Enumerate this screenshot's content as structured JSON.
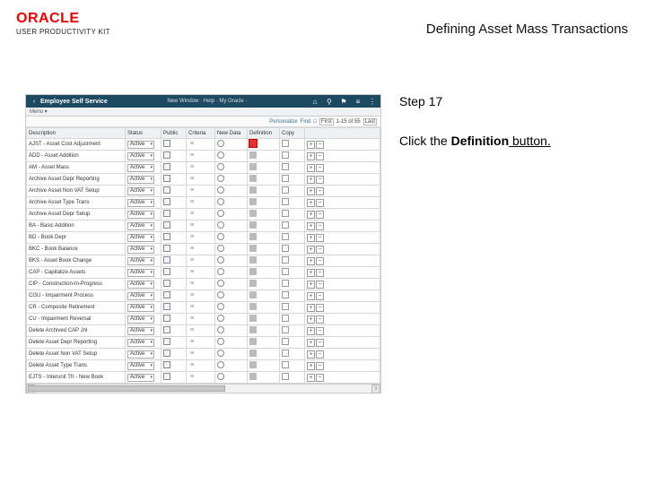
{
  "header": {
    "logo_text": "ORACLE",
    "logo_subtitle": "USER PRODUCTIVITY KIT",
    "page_title": "Defining Asset Mass Transactions"
  },
  "instruction": {
    "step_label": "Step 17",
    "sentence_prefix": "Click the ",
    "sentence_bold": "Definition",
    "sentence_suffix": " button."
  },
  "app": {
    "topbar": {
      "back_icon": "‹",
      "title": "Employee Self Service",
      "crumbs": "New Window · Help · My Oracle ·",
      "icons": {
        "home": "⌂",
        "search": "⚲",
        "flag": "⚑",
        "menu": "≡",
        "more": "⋮"
      }
    },
    "subbar_text": "Menu ▾",
    "pager": {
      "personalize": "Personalize",
      "find": "Find",
      "view_all": "□",
      "first": "First",
      "range": "1-15 of 55",
      "last": "Last"
    },
    "columns": [
      "Description",
      "Status",
      "Public",
      "Criteria",
      "New Data",
      "Definition",
      "Copy",
      ""
    ],
    "status_value": "Active",
    "rows": [
      {
        "desc": "AJST - Asset Cost Adjustment",
        "highlight": true
      },
      {
        "desc": "ADD - Asset Addition"
      },
      {
        "desc": "AM - Asset Mass"
      },
      {
        "desc": "Archive Asset Depr Reporting"
      },
      {
        "desc": "Archive Asset Non VAT Setup"
      },
      {
        "desc": "Archive Asset Type Trans"
      },
      {
        "desc": "Archive Asset Depr Setup"
      },
      {
        "desc": "BA - Basic Addition"
      },
      {
        "desc": "BD - Book Depr"
      },
      {
        "desc": "BKC - Book Balance"
      },
      {
        "desc": "BKS - Asset Book Change"
      },
      {
        "desc": "CAP - Capitalize Assets"
      },
      {
        "desc": "CIP - Construction-In-Progress"
      },
      {
        "desc": "CGU - Impairment Process"
      },
      {
        "desc": "CR - Composite Retirement"
      },
      {
        "desc": "CU - Impairment Reversal"
      },
      {
        "desc": "Delete Archived CAP Jnl"
      },
      {
        "desc": "Delete Asset Depr Reporting"
      },
      {
        "desc": "Delete Asset Non VAT Setup"
      },
      {
        "desc": "Delete Asset Type Trans"
      },
      {
        "desc": "EJTS - Interunit Tfr - New Book"
      }
    ]
  }
}
